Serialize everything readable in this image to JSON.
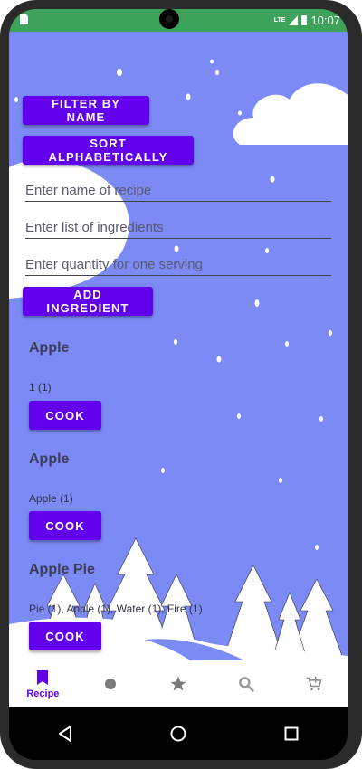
{
  "status_bar": {
    "network": "LTE",
    "time": "10:07"
  },
  "toolbar": {
    "filter_label": "FILTER BY NAME",
    "sort_label": "SORT ALPHABETICALLY"
  },
  "form": {
    "name_placeholder": "Enter name of recipe",
    "ingredients_placeholder": "Enter list of ingredients",
    "quantity_placeholder": "Enter quantity for one serving",
    "add_label": "ADD INGREDIENT"
  },
  "recipes": [
    {
      "title": "Apple",
      "ingredients": "1 (1)",
      "cook_label": "COOK"
    },
    {
      "title": "Apple",
      "ingredients": "Apple (1)",
      "cook_label": "COOK"
    },
    {
      "title": "Apple Pie",
      "ingredients": "Pie (1), Apple (1), Water (1), Fire (1)",
      "cook_label": "COOK"
    }
  ],
  "bottom_nav": {
    "items": [
      {
        "label": "Recipe",
        "icon": "bookmark-icon",
        "active": true
      },
      {
        "label": "",
        "icon": "circle-icon",
        "active": false
      },
      {
        "label": "",
        "icon": "star-icon",
        "active": false
      },
      {
        "label": "",
        "icon": "search-icon",
        "active": false
      },
      {
        "label": "",
        "icon": "cart-add-icon",
        "active": false
      }
    ]
  },
  "colors": {
    "status_bar": "#3ea35a",
    "background": "#7b8af5",
    "primary": "#6200ee",
    "nav_active": "#6200ee",
    "nav_inactive": "#7a7a7a"
  }
}
